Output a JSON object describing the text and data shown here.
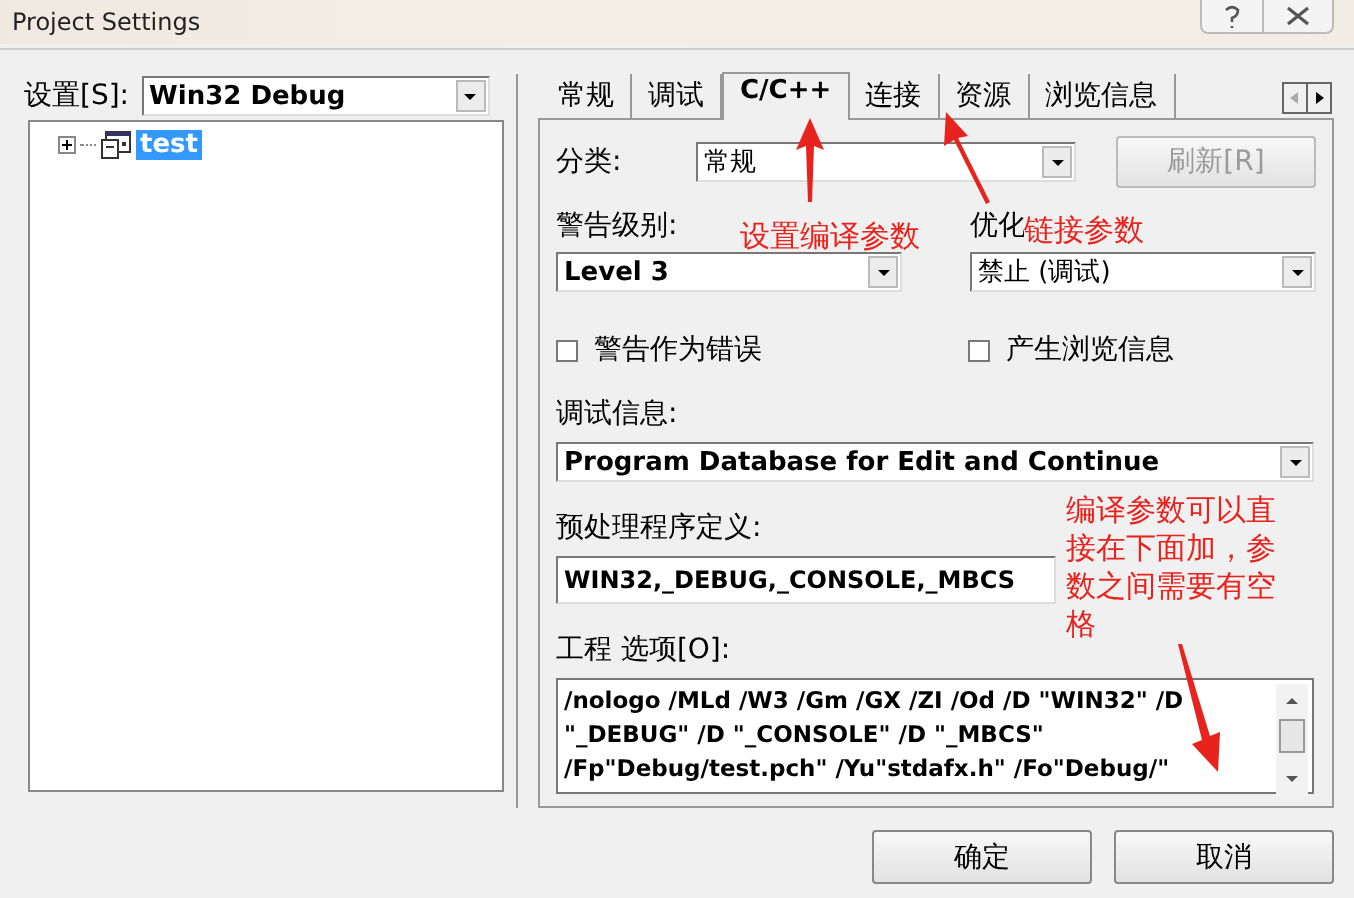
{
  "window": {
    "title": "Project Settings"
  },
  "settings": {
    "label": "设置[S]:",
    "value": "Win32 Debug"
  },
  "tree": [
    {
      "label": "test",
      "expanded": false,
      "selected": true
    }
  ],
  "tabs": [
    {
      "label": "常规",
      "selected": false
    },
    {
      "label": "调试",
      "selected": false
    },
    {
      "label": "C/C++",
      "selected": true
    },
    {
      "label": "连接",
      "selected": false
    },
    {
      "label": "资源",
      "selected": false
    },
    {
      "label": "浏览信息",
      "selected": false
    }
  ],
  "category": {
    "label": "分类:",
    "value": "常规"
  },
  "refresh_button": {
    "label": "刷新[R]",
    "disabled": true
  },
  "warning_level": {
    "label": "警告级别:",
    "value": "Level 3"
  },
  "optimization": {
    "label": "优化",
    "value": "禁止 (调试)"
  },
  "checkboxes": [
    {
      "label": "警告作为错误",
      "checked": false
    },
    {
      "label": "产生浏览信息",
      "checked": false
    }
  ],
  "debug_info": {
    "label": "调试信息:",
    "value": "Program Database for Edit and Continue"
  },
  "preprocessor": {
    "label": "预处理程序定义:",
    "value": "WIN32,_DEBUG,_CONSOLE,_MBCS"
  },
  "project_options": {
    "label": "工程 选项[O]:",
    "value": "/nologo /MLd /W3 /Gm /GX /ZI /Od /D \"WIN32\" /D \"_DEBUG\" /D \"_CONSOLE\" /D \"_MBCS\" /Fp\"Debug/test.pch\" /Yu\"stdafx.h\" /Fo\"Debug/\""
  },
  "buttons": [
    "确定",
    "取消"
  ],
  "annotations": [
    {
      "text": "设置编译参数"
    },
    {
      "text": "链接参数"
    },
    {
      "text": "编译参数可以直接在下面加，参数之间需要有空格"
    }
  ]
}
